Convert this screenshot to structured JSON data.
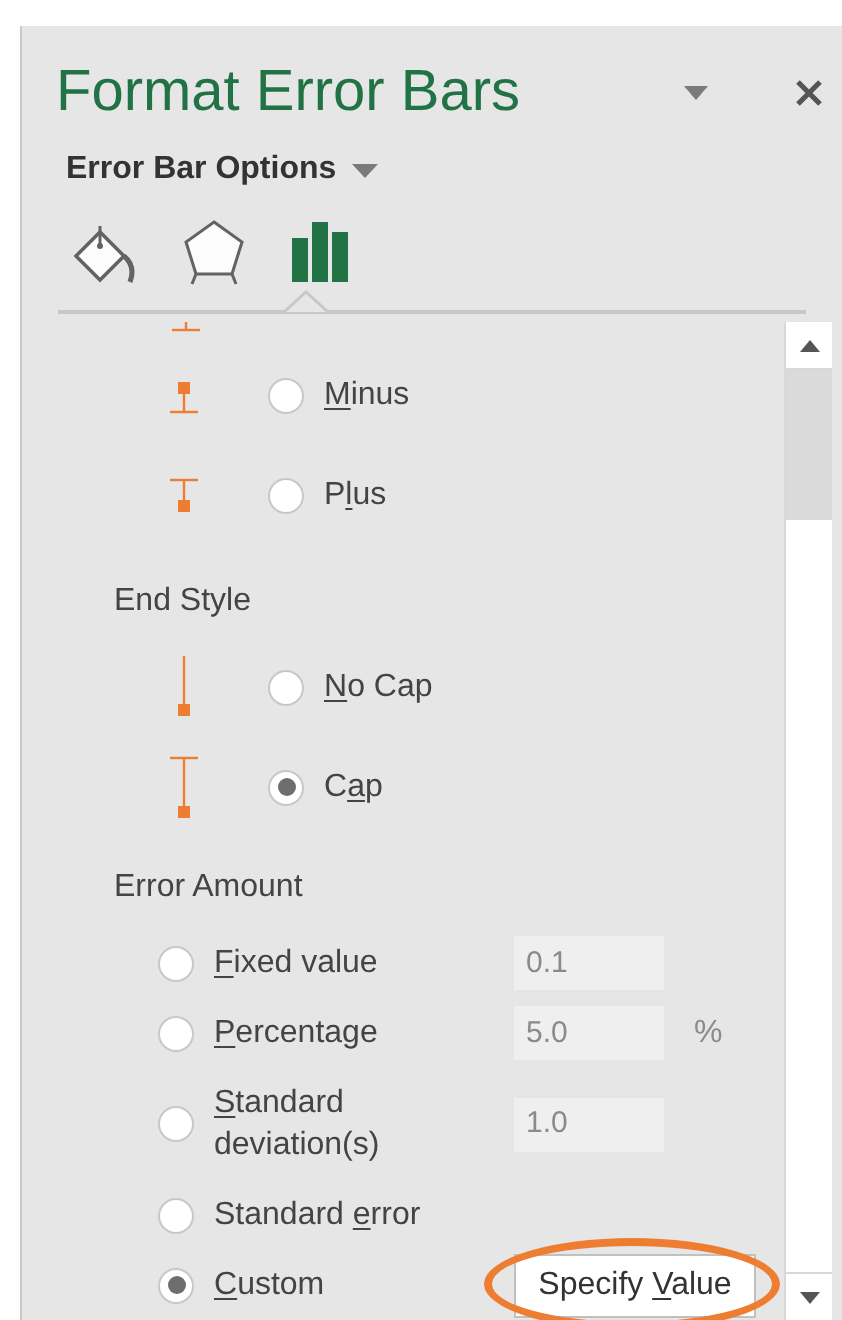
{
  "pane": {
    "title": "Format Error Bars",
    "section_menu": "Error Bar Options"
  },
  "tabs": [
    {
      "kind": "fill",
      "selected": false
    },
    {
      "kind": "effects",
      "selected": false
    },
    {
      "kind": "options",
      "selected": true
    }
  ],
  "direction": [
    {
      "kind": "minus",
      "label": {
        "key": "M",
        "post": "inus"
      },
      "selected": false
    },
    {
      "kind": "plus",
      "label": {
        "pre": "P",
        "key": "l",
        "post": "us"
      },
      "selected": false
    }
  ],
  "end_style": {
    "heading": "End Style",
    "options": [
      {
        "kind": "nocap",
        "label": {
          "key": "N",
          "post": "o Cap"
        },
        "selected": false
      },
      {
        "kind": "cap",
        "label": {
          "pre": "C",
          "key": "a",
          "post": "p"
        },
        "selected": true
      }
    ]
  },
  "error_amount": {
    "heading": "Error Amount",
    "options": [
      {
        "label": {
          "key": "F",
          "post": "ixed value"
        },
        "selected": false,
        "value": "0.1"
      },
      {
        "label": {
          "key": "P",
          "post": "ercentage"
        },
        "selected": false,
        "value": "5.0",
        "unit": "%"
      },
      {
        "label": {
          "key": "S",
          "post": "tandard deviation(s)"
        },
        "selected": false,
        "value": "1.0"
      },
      {
        "label": {
          "pre": "Standard ",
          "key": "e",
          "post": "rror"
        },
        "selected": false
      },
      {
        "label": {
          "key": "C",
          "post": "ustom"
        },
        "selected": true,
        "button": {
          "label": {
            "pre": "Specify ",
            "key": "V",
            "post": "alue"
          },
          "highlighted": true
        }
      }
    ]
  }
}
